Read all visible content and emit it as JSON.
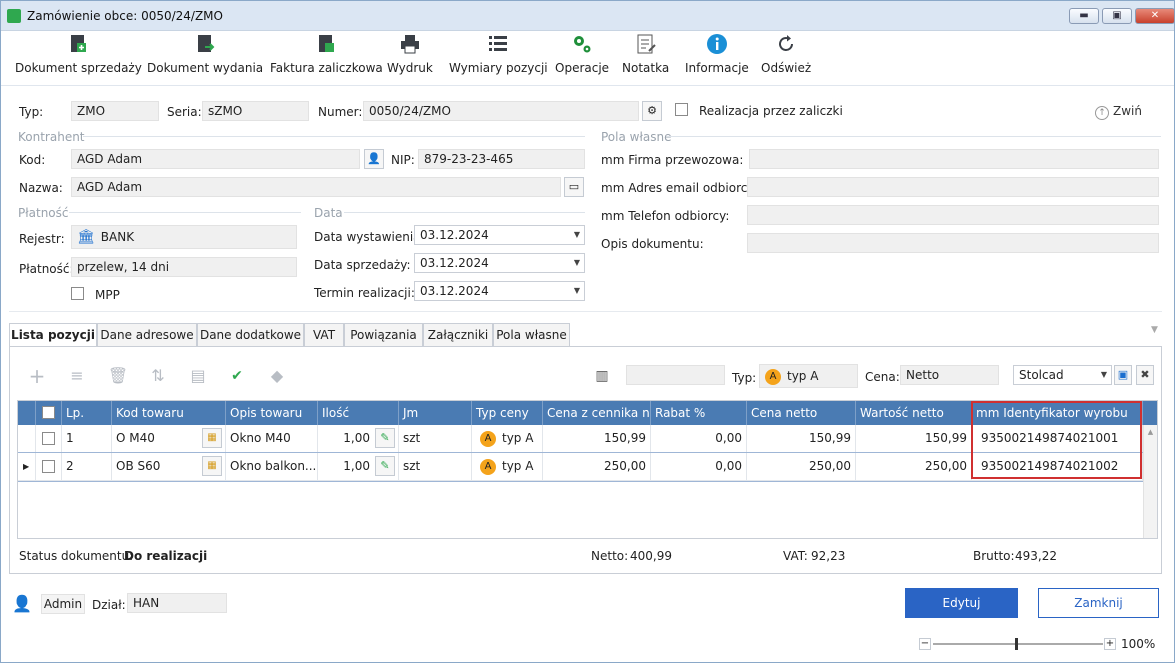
{
  "window": {
    "title": "Zamówienie obce: 0050/24/ZMO",
    "min": "▬",
    "max": "▣",
    "close": "✕"
  },
  "toolbar": [
    {
      "label": "Dokument sprzedaży",
      "icon": "document-export-icon"
    },
    {
      "label": "Dokument wydania",
      "icon": "document-out-icon"
    },
    {
      "label": "Faktura zaliczkowa",
      "icon": "invoice-icon"
    },
    {
      "label": "Wydruk",
      "icon": "printer-icon"
    },
    {
      "label": "Wymiary pozycji",
      "icon": "list-icon"
    },
    {
      "label": "Operacje",
      "icon": "gears-icon"
    },
    {
      "label": "Notatka",
      "icon": "note-icon"
    },
    {
      "label": "Informacje",
      "icon": "info-icon"
    },
    {
      "label": "Odśwież",
      "icon": "refresh-icon"
    }
  ],
  "header": {
    "typ_label": "Typ:",
    "typ": "ZMO",
    "seria_label": "Seria:",
    "seria": "sZMO",
    "numer_label": "Numer:",
    "numer": "0050/24/ZMO",
    "realizacja_label": "Realizacja przez zaliczki",
    "collapse_label": "Zwiń"
  },
  "kontrahent": {
    "group": "Kontrahent",
    "kod_label": "Kod:",
    "kod": "AGD Adam",
    "nip_label": "NIP:",
    "nip": "879-23-23-465",
    "nazwa_label": "Nazwa:",
    "nazwa": "AGD Adam"
  },
  "platnosc": {
    "group": "Płatność",
    "rejestr_label": "Rejestr:",
    "rejestr": "BANK",
    "platnosc_label": "Płatność:",
    "platnosc": "przelew, 14 dni",
    "mpp_label": "MPP"
  },
  "data": {
    "group": "Data",
    "wystawienia_label": "Data wystawienia:",
    "wystawienia": "03.12.2024",
    "sprzedazy_label": "Data sprzedaży:",
    "sprzedazy": "03.12.2024",
    "termin_label": "Termin realizacji:",
    "termin": "03.12.2024"
  },
  "pola": {
    "group": "Pola własne",
    "firma_label": "mm Firma przewozowa:",
    "email_label": "mm Adres email odbiorcy:",
    "telefon_label": "mm Telefon odbiorcy:",
    "opis_label": "Opis dokumentu:"
  },
  "tabs": [
    "Lista pozycji",
    "Dane adresowe",
    "Dane dodatkowe",
    "VAT",
    "Powiązania",
    "Załączniki",
    "Pola własne"
  ],
  "list_toolbar": {
    "typ_label": "Typ:",
    "typ_badge": "A",
    "typ_value": "typ A",
    "cena_label": "Cena:",
    "cena_value": "Netto",
    "layout_value": "Stolcad"
  },
  "grid": {
    "columns": [
      "Lp.",
      "Kod towaru",
      "Opis towaru",
      "Ilość",
      "Jm",
      "Typ ceny",
      "Cena z cennika n...",
      "Rabat %",
      "Cena netto",
      "Wartość netto",
      "mm Identyfikator wyrobu"
    ],
    "rows": [
      {
        "lp": "1",
        "kod": "O M40",
        "opis": "Okno M40",
        "ilosc": "1,00",
        "jm": "szt",
        "typ_badge": "A",
        "typ": "typ A",
        "cena_cennik": "150,99",
        "rabat": "0,00",
        "cena_netto": "150,99",
        "wartosc": "150,99",
        "ident": "935002149874021001"
      },
      {
        "lp": "2",
        "kod": "OB S60",
        "opis": "Okno  balkon...",
        "ilosc": "1,00",
        "jm": "szt",
        "typ_badge": "A",
        "typ": "typ A",
        "cena_cennik": "250,00",
        "rabat": "0,00",
        "cena_netto": "250,00",
        "wartosc": "250,00",
        "ident": "935002149874021002"
      }
    ]
  },
  "summary": {
    "status_label": "Status dokumentu:",
    "status": "Do realizacji",
    "netto_label": "Netto:",
    "netto": "400,99",
    "vat_label": "VAT:",
    "vat": "92,23",
    "brutto_label": "Brutto:",
    "brutto": "493,22"
  },
  "footer": {
    "user": "Admin",
    "dzial_label": "Dział:",
    "dzial": "HAN",
    "edit": "Edytuj",
    "close": "Zamknij",
    "zoom": "100%",
    "zoom_level": 1.0
  }
}
